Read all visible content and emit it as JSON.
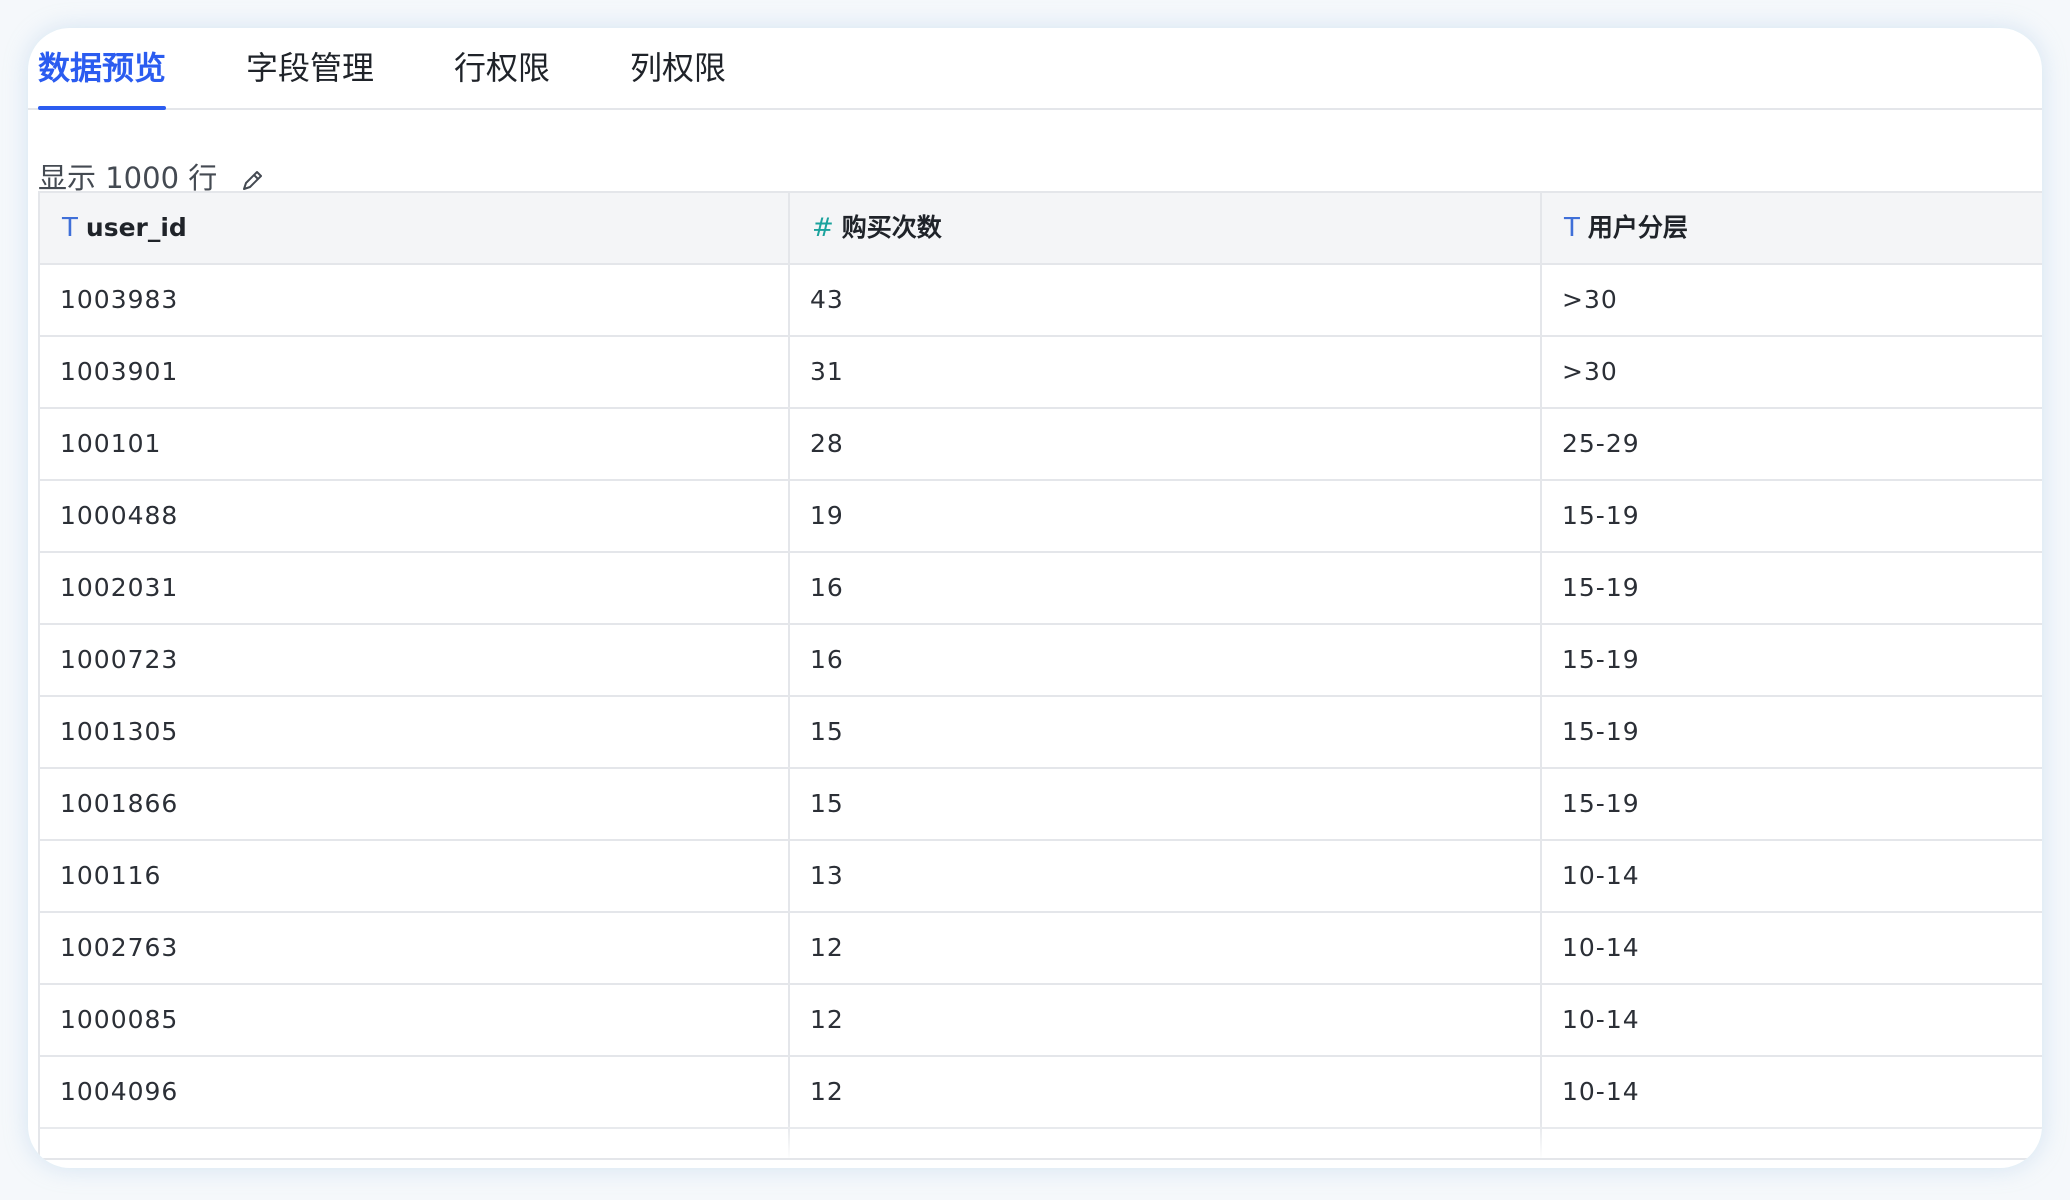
{
  "tabs": [
    {
      "label": "数据预览",
      "active": true
    },
    {
      "label": "字段管理",
      "active": false
    },
    {
      "label": "行权限",
      "active": false
    },
    {
      "label": "列权限",
      "active": false
    }
  ],
  "preview": {
    "row_limit_label": "显示 1000 行",
    "edit_icon": "pencil-icon"
  },
  "table": {
    "columns": [
      {
        "type_icon": "T",
        "type": "text",
        "name": "user_id"
      },
      {
        "type_icon": "#",
        "type": "number",
        "name": "购买次数"
      },
      {
        "type_icon": "T",
        "type": "text",
        "name": "用户分层"
      }
    ],
    "rows": [
      [
        "1003983",
        "43",
        ">30"
      ],
      [
        "1003901",
        "31",
        ">30"
      ],
      [
        "100101",
        "28",
        "25-29"
      ],
      [
        "1000488",
        "19",
        "15-19"
      ],
      [
        "1002031",
        "16",
        "15-19"
      ],
      [
        "1000723",
        "16",
        "15-19"
      ],
      [
        "1001305",
        "15",
        "15-19"
      ],
      [
        "1001866",
        "15",
        "15-19"
      ],
      [
        "100116",
        "13",
        "10-14"
      ],
      [
        "1002763",
        "12",
        "10-14"
      ],
      [
        "1000085",
        "12",
        "10-14"
      ],
      [
        "1004096",
        "12",
        "10-14"
      ]
    ]
  },
  "colors": {
    "accent": "#2b5cf0",
    "text_type_icon": "#3f6fd8",
    "number_type_icon": "#1aa29d"
  }
}
